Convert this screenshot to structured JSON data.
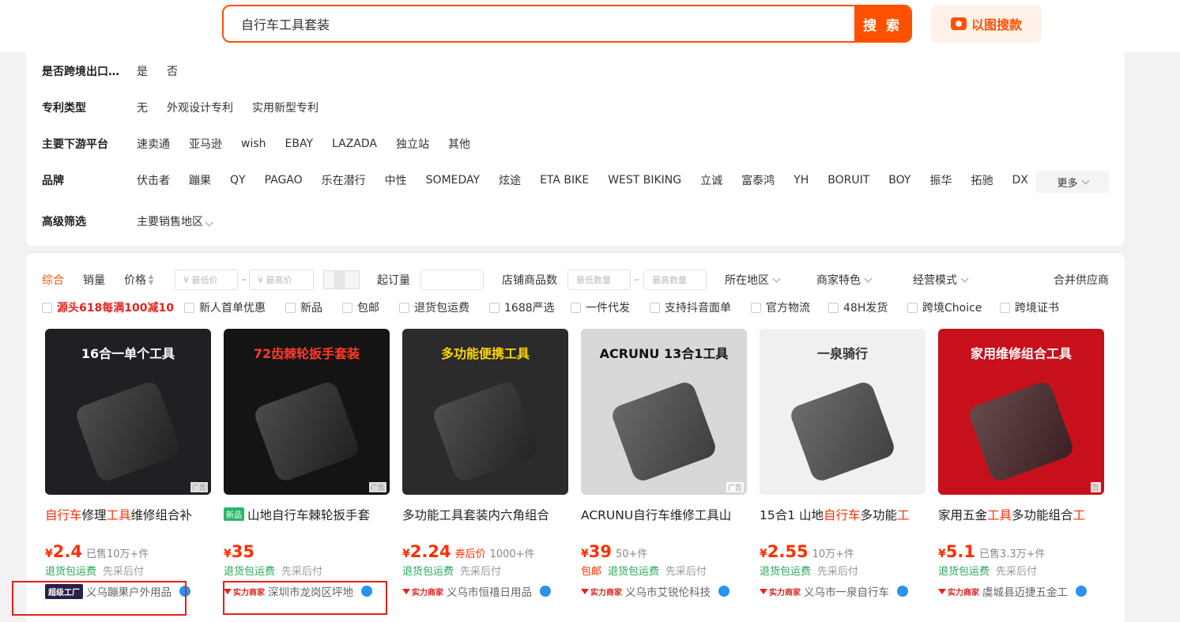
{
  "search": {
    "query": "自行车工具套装",
    "button": "搜 索",
    "image_search": "以图搜款"
  },
  "filters": {
    "rows": [
      {
        "label": "是否跨境出口…",
        "options": [
          "是",
          "否"
        ]
      },
      {
        "label": "专利类型",
        "options": [
          "无",
          "外观设计专利",
          "实用新型专利"
        ]
      },
      {
        "label": "主要下游平台",
        "options": [
          "速卖通",
          "亚马逊",
          "wish",
          "EBAY",
          "LAZADA",
          "独立站",
          "其他"
        ]
      },
      {
        "label": "品牌",
        "options": [
          "伏击者",
          "蹦果",
          "QY",
          "PAGAO",
          "乐在潜行",
          "中性",
          "SOMEDAY",
          "炫途",
          "ETA BIKE",
          "WEST BIKING",
          "立诚",
          "富泰鸿",
          "YH",
          "BORUIT",
          "BOY",
          "振华",
          "拓驰",
          "DX"
        ]
      },
      {
        "label": "高级筛选",
        "options": [
          "主要销售地区"
        ]
      }
    ],
    "more": "更多"
  },
  "sort": {
    "comprehensive": "综合",
    "sales": "销量",
    "price": "价格",
    "min_price": "¥ 最低价",
    "max_price": "¥ 最高价",
    "dash": "–",
    "moq": "起订量",
    "shop_count": "店铺商品数",
    "min_qty": "最低数量",
    "max_qty": "最高数量",
    "region": "所在地区",
    "merchant": "商家特色",
    "mode": "经营模式",
    "merge": "合并供应商"
  },
  "tags": [
    "源头618每满100减10",
    "新人首单优惠",
    "新品",
    "包邮",
    "退货包运费",
    "1688严选",
    "一件代发",
    "支持抖音面单",
    "官方物流",
    "48H发货",
    "跨境Choice",
    "跨境证书"
  ],
  "products": [
    {
      "title_parts": [
        [
          "自行车",
          true
        ],
        [
          "修理",
          false
        ],
        [
          "工具",
          true
        ],
        [
          "维修组合补",
          false
        ]
      ],
      "new": false,
      "price": "2.4",
      "coupon": "",
      "sales": "已售10万+件",
      "svc": [
        [
          "退货包运费",
          "green"
        ],
        [
          "先采后付",
          "gray"
        ]
      ],
      "badge": "超级工厂",
      "badge_type": "factory",
      "shop": "义乌蹦果户外用品",
      "img_text": "16合一单个工具",
      "img_bg": "#1f1f24",
      "img_color": "#ffffff",
      "ad": "广告"
    },
    {
      "title_parts": [
        [
          "山地自行车棘轮扳手套",
          false
        ]
      ],
      "new": true,
      "new_label": "新品",
      "price": "35",
      "coupon": "",
      "sales": "",
      "svc": [
        [
          "退货包运费",
          "green"
        ],
        [
          "先采后付",
          "gray"
        ]
      ],
      "badge": "实力商家",
      "badge_type": "power",
      "shop": "深圳市龙岗区坪地",
      "img_text": "72齿棘轮扳手套装",
      "img_bg": "#141414",
      "img_color": "#ff3a2a",
      "ad": "广告"
    },
    {
      "title_parts": [
        [
          "多功能工具套装内六角组合",
          false
        ]
      ],
      "new": false,
      "price": "2.24",
      "coupon": "券后价",
      "sales": "1000+件",
      "svc": [
        [
          "退货包运费",
          "green"
        ],
        [
          "先采后付",
          "gray"
        ]
      ],
      "badge": "实力商家",
      "badge_type": "power",
      "shop": "义乌市恒禧日用品",
      "img_text": "多功能便携工具",
      "img_bg": "#2b2b2b",
      "img_color": "#ffd400",
      "ad": ""
    },
    {
      "title_parts": [
        [
          "ACRUNU自行车维修工具山",
          false
        ]
      ],
      "new": false,
      "price": "39",
      "coupon": "",
      "sales": "50+件",
      "svc": [
        [
          "包邮",
          "red"
        ],
        [
          "退货包运费",
          "green"
        ],
        [
          "先采后付",
          "gray"
        ]
      ],
      "badge": "实力商家",
      "badge_type": "power",
      "shop": "义乌市艾锐伦科技",
      "img_text": "ACRUNU 13合1工具",
      "img_bg": "#d8d8d8",
      "img_color": "#111111",
      "ad": "广告"
    },
    {
      "title_parts": [
        [
          "15合1 山地",
          false
        ],
        [
          "自行车",
          true
        ],
        [
          "多功能",
          false
        ],
        [
          "工",
          true
        ]
      ],
      "new": false,
      "price": "2.55",
      "coupon": "",
      "sales": "10万+件",
      "svc": [
        [
          "退货包运费",
          "green"
        ],
        [
          "先采后付",
          "gray"
        ]
      ],
      "badge": "实力商家",
      "badge_type": "power",
      "shop": "义乌市一泉自行车",
      "img_text": "一泉骑行",
      "img_bg": "#f0f0f0",
      "img_color": "#333333",
      "ad": ""
    },
    {
      "title_parts": [
        [
          "家用五金",
          false
        ],
        [
          "工具",
          true
        ],
        [
          "多功能组合",
          false
        ],
        [
          "工",
          true
        ]
      ],
      "new": false,
      "price": "5.1",
      "coupon": "",
      "sales": "已售3.3万+件",
      "svc": [
        [
          "退货包运费",
          "green"
        ],
        [
          "先采后付",
          "gray"
        ]
      ],
      "badge": "实力商家",
      "badge_type": "power",
      "shop": "虞城县迈捷五金工",
      "img_text": "家用维修组合工具",
      "img_bg": "#c8101c",
      "img_color": "#ffffff",
      "ad": "告"
    }
  ]
}
